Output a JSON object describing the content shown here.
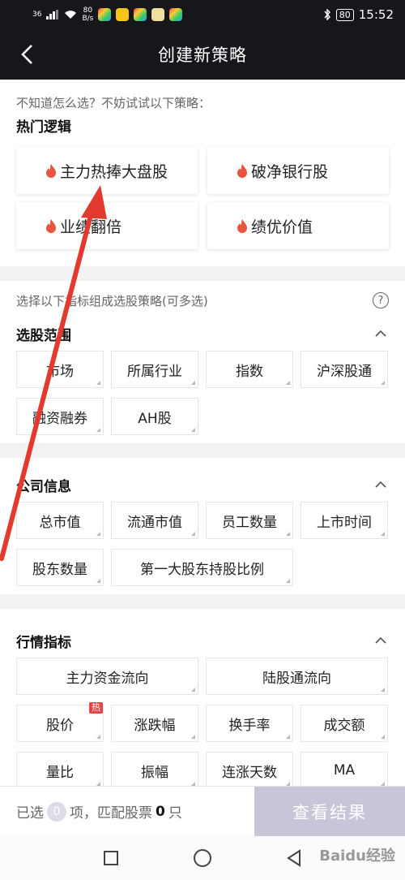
{
  "status_bar": {
    "signal": "36",
    "speed_value": "80",
    "speed_unit": "B/s",
    "battery": "80",
    "time": "15:52"
  },
  "header": {
    "title": "创建新策略",
    "back_icon": "chevron-left-icon"
  },
  "hot_logic": {
    "hint": "不知道怎么选？不妨试试以下策略：",
    "title": "热门逻辑",
    "items": [
      {
        "label": "主力热捧大盘股"
      },
      {
        "label": "破净银行股"
      },
      {
        "label": "业绩翻倍"
      },
      {
        "label": "绩优价值"
      }
    ]
  },
  "indicators": {
    "description": "选择以下指标组成选股策略(可多选)",
    "help_label": "?",
    "groups": [
      {
        "title": "选股范围",
        "items": [
          {
            "label": "市场"
          },
          {
            "label": "所属行业"
          },
          {
            "label": "指数"
          },
          {
            "label": "沪深股通"
          },
          {
            "label": "融资融券"
          },
          {
            "label": "AH股"
          }
        ]
      },
      {
        "title": "公司信息",
        "items": [
          {
            "label": "总市值"
          },
          {
            "label": "流通市值"
          },
          {
            "label": "员工数量"
          },
          {
            "label": "上市时间"
          },
          {
            "label": "股东数量"
          },
          {
            "label": "第一大股东持股比例"
          }
        ]
      },
      {
        "title": "行情指标",
        "items": [
          {
            "label": "主力资金流向"
          },
          {
            "label": "陆股通流向"
          },
          {
            "label": "股价",
            "badge": "热"
          },
          {
            "label": "涨跌幅"
          },
          {
            "label": "换手率"
          },
          {
            "label": "成交额"
          },
          {
            "label": "量比"
          },
          {
            "label": "振幅"
          },
          {
            "label": "连涨天数"
          },
          {
            "label": "MA"
          }
        ]
      }
    ]
  },
  "footer": {
    "selected_prefix": "已选",
    "selected_count": "0",
    "selected_mid": "项，匹配股票",
    "match_count": "0",
    "match_suffix": "只",
    "view_button": "查看结果"
  },
  "watermark": "Baidu经验",
  "colors": {
    "header_bg": "#17171b",
    "flame": "#e8553e",
    "button_disabled": "#c6c6d8",
    "arrow": "#e23a2e",
    "badge": "#e64545"
  }
}
